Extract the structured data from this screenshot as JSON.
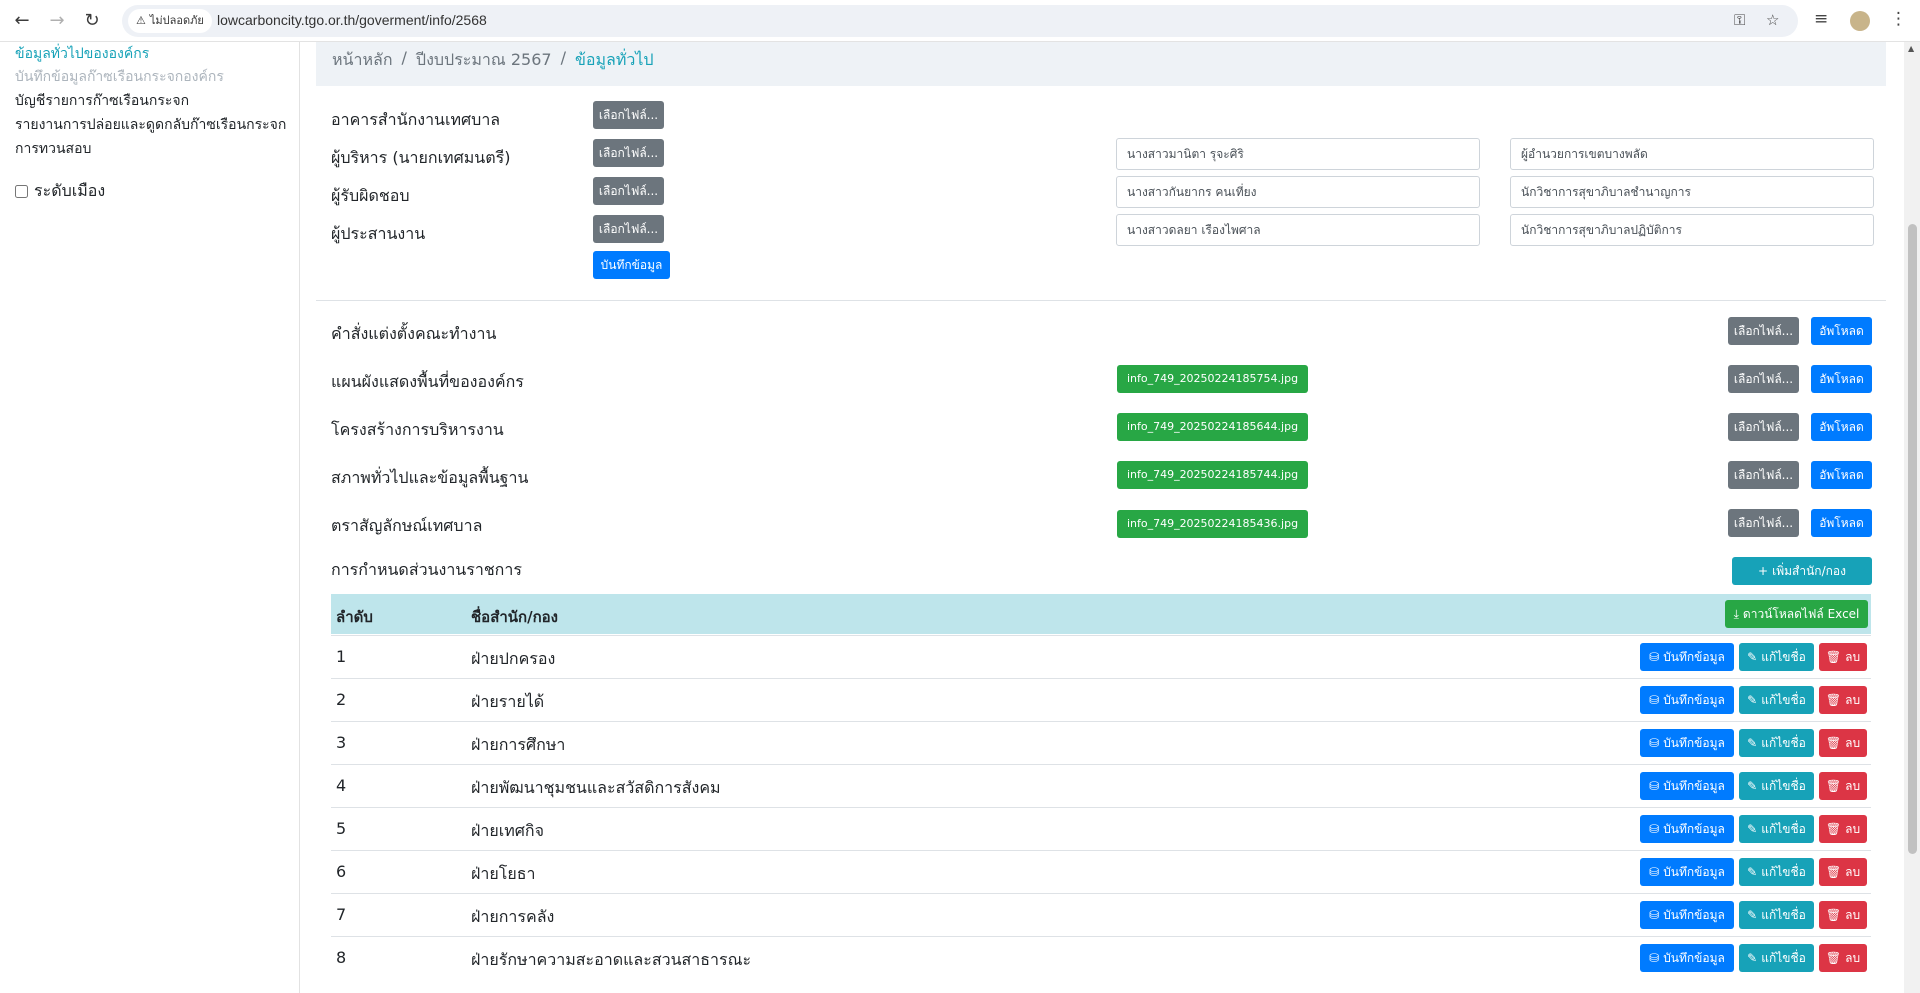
{
  "browser": {
    "security_label": "ไม่ปลอดภัย",
    "url": "lowcarboncity.tgo.or.th/goverment/info/2568"
  },
  "sidebar": {
    "items": [
      {
        "label": "ข้อมูลทั่วไปขององค์กร",
        "state": "active"
      },
      {
        "label": "บันทึกข้อมูลก๊าซเรือนกระจกองค์กร",
        "state": "disabled"
      },
      {
        "label": "บัญชีรายการก๊าซเรือนกระจก",
        "state": "normal"
      },
      {
        "label": "รายงานการปล่อยและดูดกลับก๊าซเรือนกระจก",
        "state": "normal"
      },
      {
        "label": "การทวนสอบ",
        "state": "normal"
      }
    ],
    "checkbox_label": "ระดับเมือง"
  },
  "breadcrumb": {
    "home": "หน้าหลัก",
    "year": "ปีงบประมาณ 2567",
    "current": "ข้อมูลทั่วไป"
  },
  "choose_file_label": "เลือกไฟล์...",
  "upload_label": "อัพโหลด",
  "personnel": [
    {
      "label": "อาคารสำนักงานเทศบาล"
    },
    {
      "label": "ผู้บริหาร (นายกเทศมนตรี)",
      "name": "นางสาวมานิตา รุจะศิริ",
      "position": "ผู้อำนวยการเขตบางพลัด"
    },
    {
      "label": "ผู้รับผิดชอบ",
      "name": "นางสาวกันยากร คนเที่ยง",
      "position": "นักวิชาการสุขาภิบาลชำนาญการ"
    },
    {
      "label": "ผู้ประสานงาน",
      "name": "นางสาวดลยา เรืองไพศาล",
      "position": "นักวิชาการสุขาภิบาลปฏิบัติการ"
    }
  ],
  "save_label": "บันทึกข้อมูล",
  "documents": [
    {
      "label": "คำสั่งแต่งตั้งคณะทำงาน",
      "file": ""
    },
    {
      "label": "แผนผังแสดงพื้นที่ขององค์กร",
      "file": "info_749_20250224185754.jpg"
    },
    {
      "label": "โครงสร้างการบริหารงาน",
      "file": "info_749_20250224185644.jpg"
    },
    {
      "label": "สภาพทั่วไปและข้อมูลพื้นฐาน",
      "file": "info_749_20250224185744.jpg"
    },
    {
      "label": "ตราสัญลักษณ์เทศบาล",
      "file": "info_749_20250224185436.jpg"
    }
  ],
  "departments": {
    "title": "การกำหนดส่วนงานราชการ",
    "add_button": "เพิ่มสำนัก/กอง",
    "col_no": "ลำดับ",
    "col_name": "ชื่อสำนัก/กอง",
    "download_button": "ดาวน์โหลดไฟล์ Excel",
    "action_save": "บันทึกข้อมูล",
    "action_edit": "แก้ไขชื่อ",
    "action_delete": "ลบ",
    "rows": [
      {
        "no": "1",
        "name": "ฝ่ายปกครอง"
      },
      {
        "no": "2",
        "name": "ฝ่ายรายได้"
      },
      {
        "no": "3",
        "name": "ฝ่ายการศึกษา"
      },
      {
        "no": "4",
        "name": "ฝ่ายพัฒนาชุมชนและสวัสดิการสังคม"
      },
      {
        "no": "5",
        "name": "ฝ่ายเทศกิจ"
      },
      {
        "no": "6",
        "name": "ฝ่ายโยธา"
      },
      {
        "no": "7",
        "name": "ฝ่ายการคลัง"
      },
      {
        "no": "8",
        "name": "ฝ่ายรักษาความสะอาดและสวนสาธารณะ"
      }
    ]
  },
  "colors": {
    "primary": "#007bff",
    "info": "#17a2b8",
    "success": "#28a745",
    "danger": "#dc3545",
    "secondary": "#6c757d",
    "table_header": "#bee5eb"
  }
}
